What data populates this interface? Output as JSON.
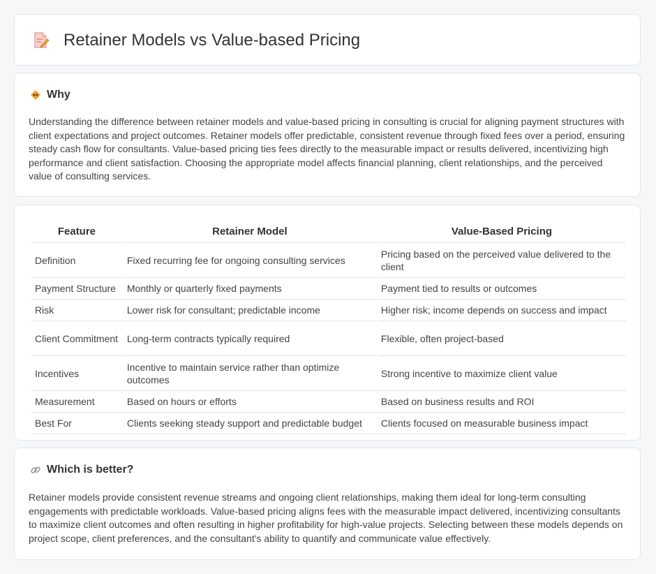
{
  "header": {
    "title": "Retainer Models vs Value-based Pricing",
    "icon": "document-pencil-icon"
  },
  "why": {
    "icon": "handshake-icon",
    "title": "Why",
    "body": "Understanding the difference between retainer models and value-based pricing in consulting is crucial for aligning payment structures with client expectations and project outcomes. Retainer models offer predictable, consistent revenue through fixed fees over a period, ensuring steady cash flow for consultants. Value-based pricing ties fees directly to the measurable impact or results delivered, incentivizing high performance and client satisfaction. Choosing the appropriate model affects financial planning, client relationships, and the perceived value of consulting services."
  },
  "table": {
    "headers": [
      "Feature",
      "Retainer Model",
      "Value-Based Pricing"
    ],
    "rows": [
      [
        "Definition",
        "Fixed recurring fee for ongoing consulting services",
        "Pricing based on the perceived value delivered to the client"
      ],
      [
        "Payment Structure",
        "Monthly or quarterly fixed payments",
        "Payment tied to results or outcomes"
      ],
      [
        "Risk",
        "Lower risk for consultant; predictable income",
        "Higher risk; income depends on success and impact"
      ],
      [
        "Client Commitment",
        "Long-term contracts typically required",
        "Flexible, often project-based"
      ],
      [
        "Incentives",
        "Incentive to maintain service rather than optimize outcomes",
        "Strong incentive to maximize client value"
      ],
      [
        "Measurement",
        "Based on hours or efforts",
        "Based on business results and ROI"
      ],
      [
        "Best For",
        "Clients seeking steady support and predictable budget",
        "Clients focused on measurable business impact"
      ]
    ]
  },
  "better": {
    "icon": "link-icon",
    "title": "Which is better?",
    "body": "Retainer models provide consistent revenue streams and ongoing client relationships, making them ideal for long-term consulting engagements with predictable workloads. Value-based pricing aligns fees with the measurable impact delivered, incentivizing consultants to maximize client outcomes and often resulting in higher profitability for high-value projects. Selecting between these models depends on project scope, client preferences, and the consultant's ability to quantify and communicate value effectively."
  },
  "colors": {
    "accent_orange": "#f0a23a",
    "icon_red": "#e0625a",
    "border": "#e4e6ea"
  }
}
